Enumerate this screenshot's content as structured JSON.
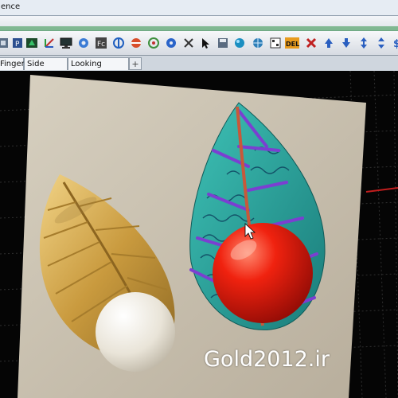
{
  "window": {
    "title_fragment": "ence"
  },
  "toolbar": {
    "icons": [
      "dimension-icon",
      "properties-icon",
      "gem-icon",
      "axis-icon",
      "monitor-icon",
      "settings-gear-icon",
      "layers-icon",
      "half-circle-icon",
      "split-sphere-icon",
      "rotate-icon",
      "scissors-icon",
      "save-icon",
      "sphere-icon",
      "grid-icon",
      "del-icon",
      "close-icon",
      "move-up-icon",
      "move-down-icon",
      "move-both-icon",
      "dollar-icon"
    ],
    "del_label": "DEL"
  },
  "tabs": [
    {
      "label": "Finger"
    },
    {
      "label": "Side View"
    },
    {
      "label": "Looking Down"
    }
  ],
  "tab_add_label": "+",
  "viewport": {
    "watermark": "Gold2012.ir"
  },
  "colors": {
    "toolbar_bg": "#e3e7ec",
    "viewport_bg": "#050505",
    "grid_line": "#3a3a3a",
    "axis_red": "#c21e1e",
    "leaf_teal": "#2aa6a0",
    "vein_purple": "#7b3fd1",
    "sphere_red": "#e01a10",
    "gold": "#c9a24a"
  }
}
